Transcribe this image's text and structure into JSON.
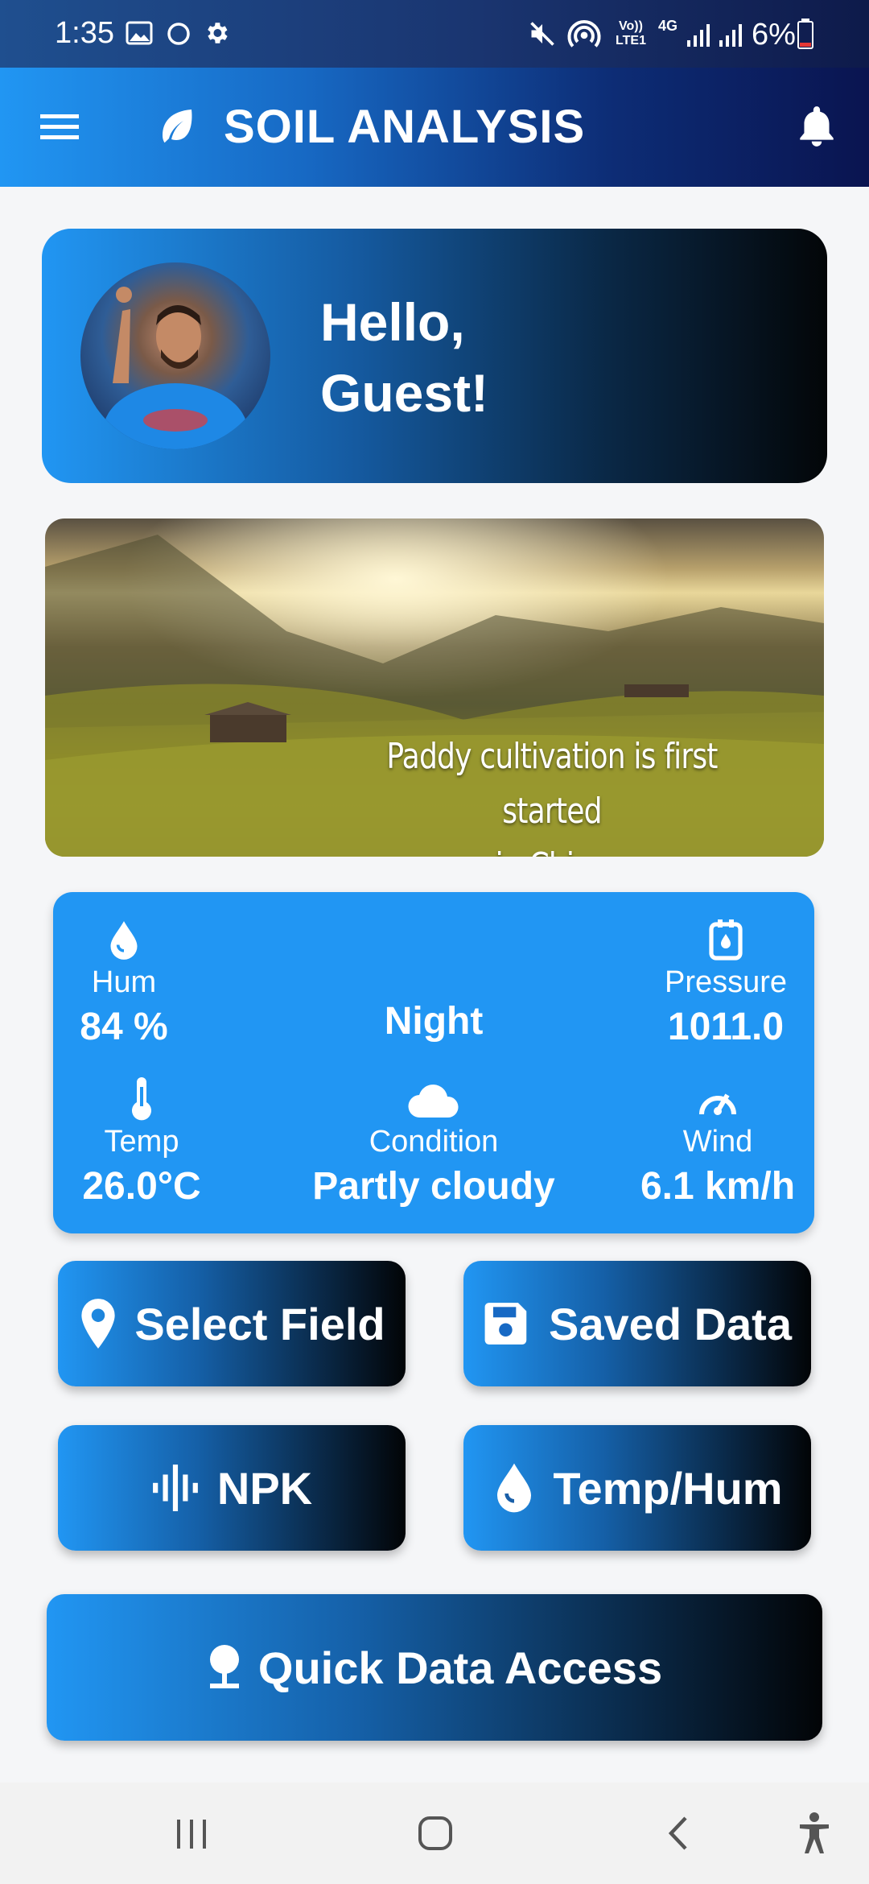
{
  "status_bar": {
    "time": "1:35",
    "battery": "6%",
    "network": "4G",
    "volte": "Vo)) LTE1"
  },
  "app_bar": {
    "title": "SOIL ANALYSIS"
  },
  "greeting": {
    "line1": "Hello,",
    "line2": "Guest!"
  },
  "banner": {
    "caption_line1": "Paddy cultivation is first started",
    "caption_line2": "in China"
  },
  "weather": {
    "humidity": {
      "label": "Hum",
      "value": "84 %"
    },
    "time_of_day": {
      "value": "Night"
    },
    "pressure": {
      "label": "Pressure",
      "value": "1011.0"
    },
    "temperature": {
      "label": "Temp",
      "value": "26.0°C"
    },
    "condition": {
      "label": "Condition",
      "value": "Partly cloudy"
    },
    "wind": {
      "label": "Wind",
      "value": "6.1 km/h"
    }
  },
  "buttons": {
    "select_field": "Select Field",
    "saved_data": "Saved Data",
    "npk": "NPK",
    "temp_hum": "Temp/Hum",
    "quick_access": "Quick Data Access"
  },
  "colors": {
    "accent": "#2196f3",
    "dark": "#030608",
    "appbar_end": "#0a1450"
  }
}
